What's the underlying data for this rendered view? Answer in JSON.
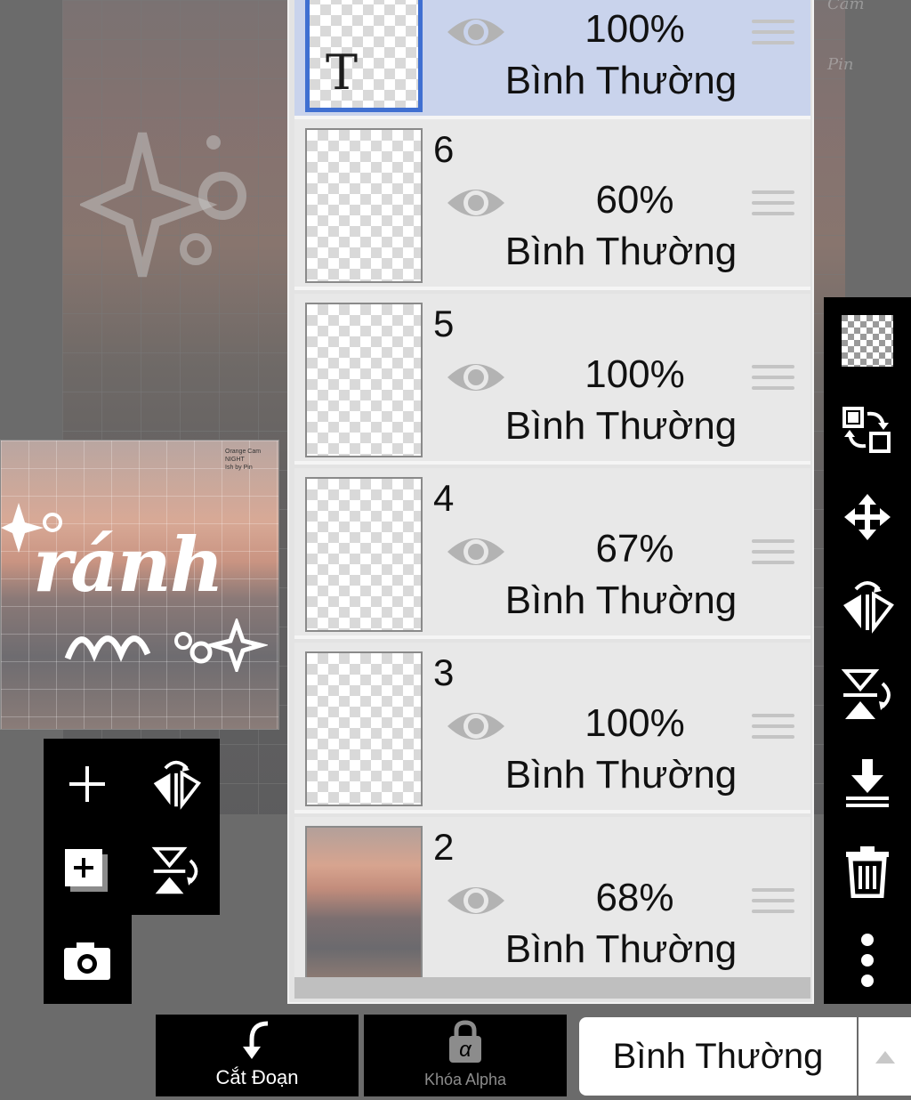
{
  "canvas": {
    "corner_text_top": "Cam",
    "corner_text_pin": "Pin"
  },
  "preview": {
    "title_text": "ránh",
    "note_text": "Orange Cam\nNIGHT\nIsh by Pin"
  },
  "layers": [
    {
      "number": "",
      "thumbnail": "text-layer",
      "thumb_glyph": "T",
      "opacity": "100%",
      "blend": "Bình Thường",
      "selected": true
    },
    {
      "number": "6",
      "thumbnail": "transparent",
      "opacity": "60%",
      "blend": "Bình Thường",
      "selected": false
    },
    {
      "number": "5",
      "thumbnail": "transparent",
      "opacity": "100%",
      "blend": "Bình Thường",
      "selected": false
    },
    {
      "number": "4",
      "thumbnail": "transparent",
      "opacity": "67%",
      "blend": "Bình Thường",
      "selected": false
    },
    {
      "number": "3",
      "thumbnail": "transparent",
      "opacity": "100%",
      "blend": "Bình Thường",
      "selected": false
    },
    {
      "number": "2",
      "thumbnail": "photo",
      "opacity": "68%",
      "blend": "Bình Thường",
      "selected": false
    }
  ],
  "right_toolbar": [
    "checkerboard-icon",
    "swap-layer-icon",
    "move-icon",
    "flip-horizontal-icon",
    "flip-vertical-icon",
    "merge-down-icon",
    "trash-icon",
    "more-options-icon"
  ],
  "left_toolbar": [
    "add-layer-icon",
    "flip-horizontal-icon",
    "add-copy-layer-icon",
    "flip-vertical-icon",
    "camera-icon"
  ],
  "bottom_bar": {
    "clip_label": "Cắt Đoạn",
    "alpha_lock_label": "Khóa Alpha",
    "alpha_glyph": "α",
    "blend_mode_value": "Bình Thường"
  },
  "colors": {
    "selected_row": "#c9d3ec",
    "selected_border": "#3f6fd1",
    "toolbar": "#000000",
    "panel": "#e3e3e3"
  }
}
